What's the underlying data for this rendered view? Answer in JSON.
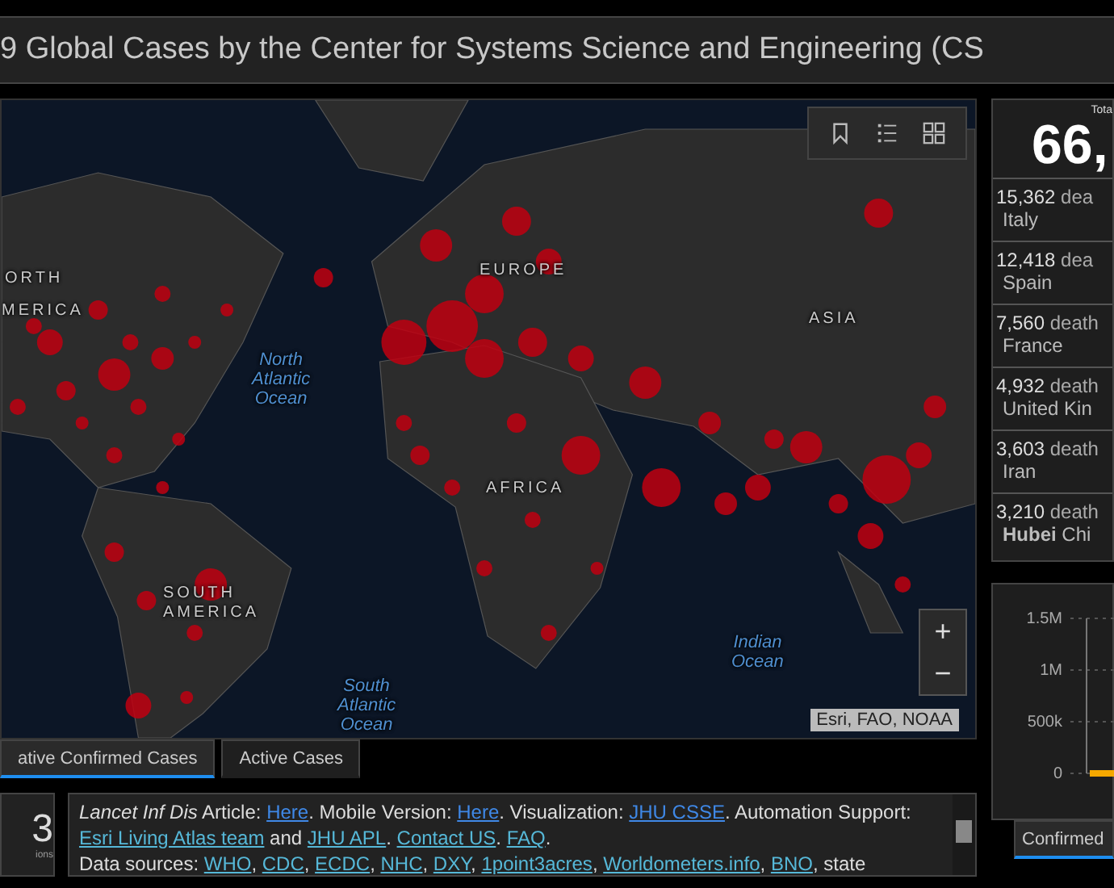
{
  "title": "9 Global Cases by the Center for Systems Science and Engineering (CS",
  "map": {
    "labels": [
      {
        "text": "ORTH",
        "kind": "continent"
      },
      {
        "text": "MERICA",
        "kind": "continent"
      },
      {
        "text": "EUROPE",
        "kind": "continent"
      },
      {
        "text": "ASIA",
        "kind": "continent"
      },
      {
        "text": "AFRICA",
        "kind": "continent"
      },
      {
        "text": "SOUTH\nAMERICA",
        "kind": "continent"
      },
      {
        "text": "North\nAtlantic\nOcean",
        "kind": "ocean"
      },
      {
        "text": "South\nAtlantic\nOcean",
        "kind": "ocean"
      },
      {
        "text": "Indian\nOcean",
        "kind": "ocean"
      }
    ],
    "attribution": "Esri, FAO, NOAA",
    "zoom_in": "+",
    "zoom_out": "−"
  },
  "map_tabs": [
    {
      "label": "ative Confirmed Cases",
      "selected": true
    },
    {
      "label": "Active Cases",
      "selected": false
    }
  ],
  "counter": {
    "value": "3",
    "caption": "ions"
  },
  "info": [
    {
      "text": "Lancet Inf Dis",
      "kind": "italic"
    },
    {
      "text": " Article: ",
      "kind": "plain"
    },
    {
      "text": "Here",
      "kind": "link",
      "visited": true
    },
    {
      "text": ". Mobile Version: ",
      "kind": "plain"
    },
    {
      "text": "Here",
      "kind": "link",
      "visited": true
    },
    {
      "text": ". Visualization: ",
      "kind": "plain"
    },
    {
      "text": "JHU CSSE",
      "kind": "link",
      "visited": true
    },
    {
      "text": ". Automation Support: ",
      "kind": "plain"
    },
    {
      "text": "Esri Living Atlas team",
      "kind": "link",
      "visited": false
    },
    {
      "text": " and ",
      "kind": "plain"
    },
    {
      "text": "JHU APL",
      "kind": "link",
      "visited": false
    },
    {
      "text": ". ",
      "kind": "plain"
    },
    {
      "text": "Contact US",
      "kind": "link",
      "visited": false
    },
    {
      "text": ". ",
      "kind": "plain"
    },
    {
      "text": "FAQ",
      "kind": "link",
      "visited": false
    },
    {
      "text": ".",
      "kind": "plain"
    },
    {
      "kind": "break"
    },
    {
      "text": "Data sources: ",
      "kind": "plain"
    },
    {
      "text": "WHO",
      "kind": "link",
      "visited": false
    },
    {
      "text": ", ",
      "kind": "plain"
    },
    {
      "text": "CDC",
      "kind": "link",
      "visited": false
    },
    {
      "text": ", ",
      "kind": "plain"
    },
    {
      "text": "ECDC",
      "kind": "link",
      "visited": false
    },
    {
      "text": ", ",
      "kind": "plain"
    },
    {
      "text": "NHC",
      "kind": "link",
      "visited": false
    },
    {
      "text": ", ",
      "kind": "plain"
    },
    {
      "text": "DXY",
      "kind": "link",
      "visited": false
    },
    {
      "text": ", ",
      "kind": "plain"
    },
    {
      "text": "1point3acres",
      "kind": "link",
      "visited": false
    },
    {
      "text": ", ",
      "kind": "plain"
    },
    {
      "text": "Worldometers.info",
      "kind": "link",
      "visited": false
    },
    {
      "text": ", ",
      "kind": "plain"
    },
    {
      "text": "BNO",
      "kind": "link",
      "visited": false
    },
    {
      "text": ", state",
      "kind": "plain"
    }
  ],
  "deaths": {
    "total_label": "Tota",
    "total": "66,",
    "rows": [
      {
        "value": "15,362",
        "unit": "dea",
        "place": "Italy"
      },
      {
        "value": "12,418",
        "unit": "dea",
        "place": "Spain"
      },
      {
        "value": "7,560",
        "unit": "death",
        "place": "France"
      },
      {
        "value": "4,932",
        "unit": "death",
        "place": "United Kin"
      },
      {
        "value": "3,603",
        "unit": "death",
        "place": "Iran"
      },
      {
        "value": "3,210",
        "unit": "death",
        "place": "**Hubei** Chi"
      }
    ]
  },
  "chart": {
    "axis_labels": [
      "1.5M",
      "1M",
      "500k",
      "0"
    ]
  },
  "chart_tabs": [
    {
      "label": "Confirmed",
      "selected": true
    }
  ]
}
